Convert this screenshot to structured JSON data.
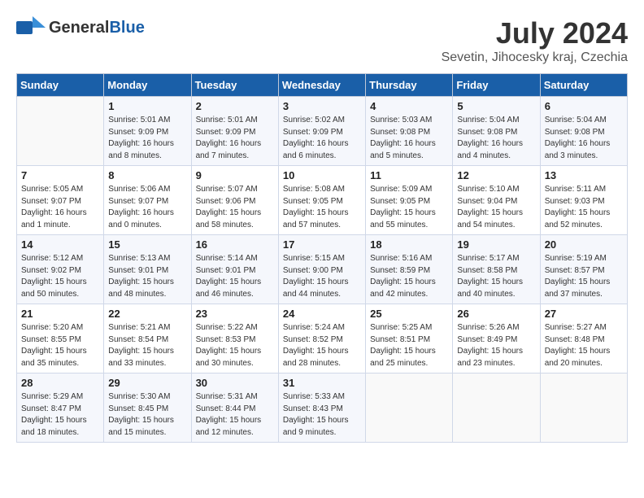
{
  "logo": {
    "general": "General",
    "blue": "Blue"
  },
  "title": "July 2024",
  "location": "Sevetin, Jihocesky kraj, Czechia",
  "weekdays": [
    "Sunday",
    "Monday",
    "Tuesday",
    "Wednesday",
    "Thursday",
    "Friday",
    "Saturday"
  ],
  "weeks": [
    [
      {
        "day": "",
        "info": ""
      },
      {
        "day": "1",
        "info": "Sunrise: 5:01 AM\nSunset: 9:09 PM\nDaylight: 16 hours\nand 8 minutes."
      },
      {
        "day": "2",
        "info": "Sunrise: 5:01 AM\nSunset: 9:09 PM\nDaylight: 16 hours\nand 7 minutes."
      },
      {
        "day": "3",
        "info": "Sunrise: 5:02 AM\nSunset: 9:09 PM\nDaylight: 16 hours\nand 6 minutes."
      },
      {
        "day": "4",
        "info": "Sunrise: 5:03 AM\nSunset: 9:08 PM\nDaylight: 16 hours\nand 5 minutes."
      },
      {
        "day": "5",
        "info": "Sunrise: 5:04 AM\nSunset: 9:08 PM\nDaylight: 16 hours\nand 4 minutes."
      },
      {
        "day": "6",
        "info": "Sunrise: 5:04 AM\nSunset: 9:08 PM\nDaylight: 16 hours\nand 3 minutes."
      }
    ],
    [
      {
        "day": "7",
        "info": "Sunrise: 5:05 AM\nSunset: 9:07 PM\nDaylight: 16 hours\nand 1 minute."
      },
      {
        "day": "8",
        "info": "Sunrise: 5:06 AM\nSunset: 9:07 PM\nDaylight: 16 hours\nand 0 minutes."
      },
      {
        "day": "9",
        "info": "Sunrise: 5:07 AM\nSunset: 9:06 PM\nDaylight: 15 hours\nand 58 minutes."
      },
      {
        "day": "10",
        "info": "Sunrise: 5:08 AM\nSunset: 9:05 PM\nDaylight: 15 hours\nand 57 minutes."
      },
      {
        "day": "11",
        "info": "Sunrise: 5:09 AM\nSunset: 9:05 PM\nDaylight: 15 hours\nand 55 minutes."
      },
      {
        "day": "12",
        "info": "Sunrise: 5:10 AM\nSunset: 9:04 PM\nDaylight: 15 hours\nand 54 minutes."
      },
      {
        "day": "13",
        "info": "Sunrise: 5:11 AM\nSunset: 9:03 PM\nDaylight: 15 hours\nand 52 minutes."
      }
    ],
    [
      {
        "day": "14",
        "info": "Sunrise: 5:12 AM\nSunset: 9:02 PM\nDaylight: 15 hours\nand 50 minutes."
      },
      {
        "day": "15",
        "info": "Sunrise: 5:13 AM\nSunset: 9:01 PM\nDaylight: 15 hours\nand 48 minutes."
      },
      {
        "day": "16",
        "info": "Sunrise: 5:14 AM\nSunset: 9:01 PM\nDaylight: 15 hours\nand 46 minutes."
      },
      {
        "day": "17",
        "info": "Sunrise: 5:15 AM\nSunset: 9:00 PM\nDaylight: 15 hours\nand 44 minutes."
      },
      {
        "day": "18",
        "info": "Sunrise: 5:16 AM\nSunset: 8:59 PM\nDaylight: 15 hours\nand 42 minutes."
      },
      {
        "day": "19",
        "info": "Sunrise: 5:17 AM\nSunset: 8:58 PM\nDaylight: 15 hours\nand 40 minutes."
      },
      {
        "day": "20",
        "info": "Sunrise: 5:19 AM\nSunset: 8:57 PM\nDaylight: 15 hours\nand 37 minutes."
      }
    ],
    [
      {
        "day": "21",
        "info": "Sunrise: 5:20 AM\nSunset: 8:55 PM\nDaylight: 15 hours\nand 35 minutes."
      },
      {
        "day": "22",
        "info": "Sunrise: 5:21 AM\nSunset: 8:54 PM\nDaylight: 15 hours\nand 33 minutes."
      },
      {
        "day": "23",
        "info": "Sunrise: 5:22 AM\nSunset: 8:53 PM\nDaylight: 15 hours\nand 30 minutes."
      },
      {
        "day": "24",
        "info": "Sunrise: 5:24 AM\nSunset: 8:52 PM\nDaylight: 15 hours\nand 28 minutes."
      },
      {
        "day": "25",
        "info": "Sunrise: 5:25 AM\nSunset: 8:51 PM\nDaylight: 15 hours\nand 25 minutes."
      },
      {
        "day": "26",
        "info": "Sunrise: 5:26 AM\nSunset: 8:49 PM\nDaylight: 15 hours\nand 23 minutes."
      },
      {
        "day": "27",
        "info": "Sunrise: 5:27 AM\nSunset: 8:48 PM\nDaylight: 15 hours\nand 20 minutes."
      }
    ],
    [
      {
        "day": "28",
        "info": "Sunrise: 5:29 AM\nSunset: 8:47 PM\nDaylight: 15 hours\nand 18 minutes."
      },
      {
        "day": "29",
        "info": "Sunrise: 5:30 AM\nSunset: 8:45 PM\nDaylight: 15 hours\nand 15 minutes."
      },
      {
        "day": "30",
        "info": "Sunrise: 5:31 AM\nSunset: 8:44 PM\nDaylight: 15 hours\nand 12 minutes."
      },
      {
        "day": "31",
        "info": "Sunrise: 5:33 AM\nSunset: 8:43 PM\nDaylight: 15 hours\nand 9 minutes."
      },
      {
        "day": "",
        "info": ""
      },
      {
        "day": "",
        "info": ""
      },
      {
        "day": "",
        "info": ""
      }
    ]
  ]
}
